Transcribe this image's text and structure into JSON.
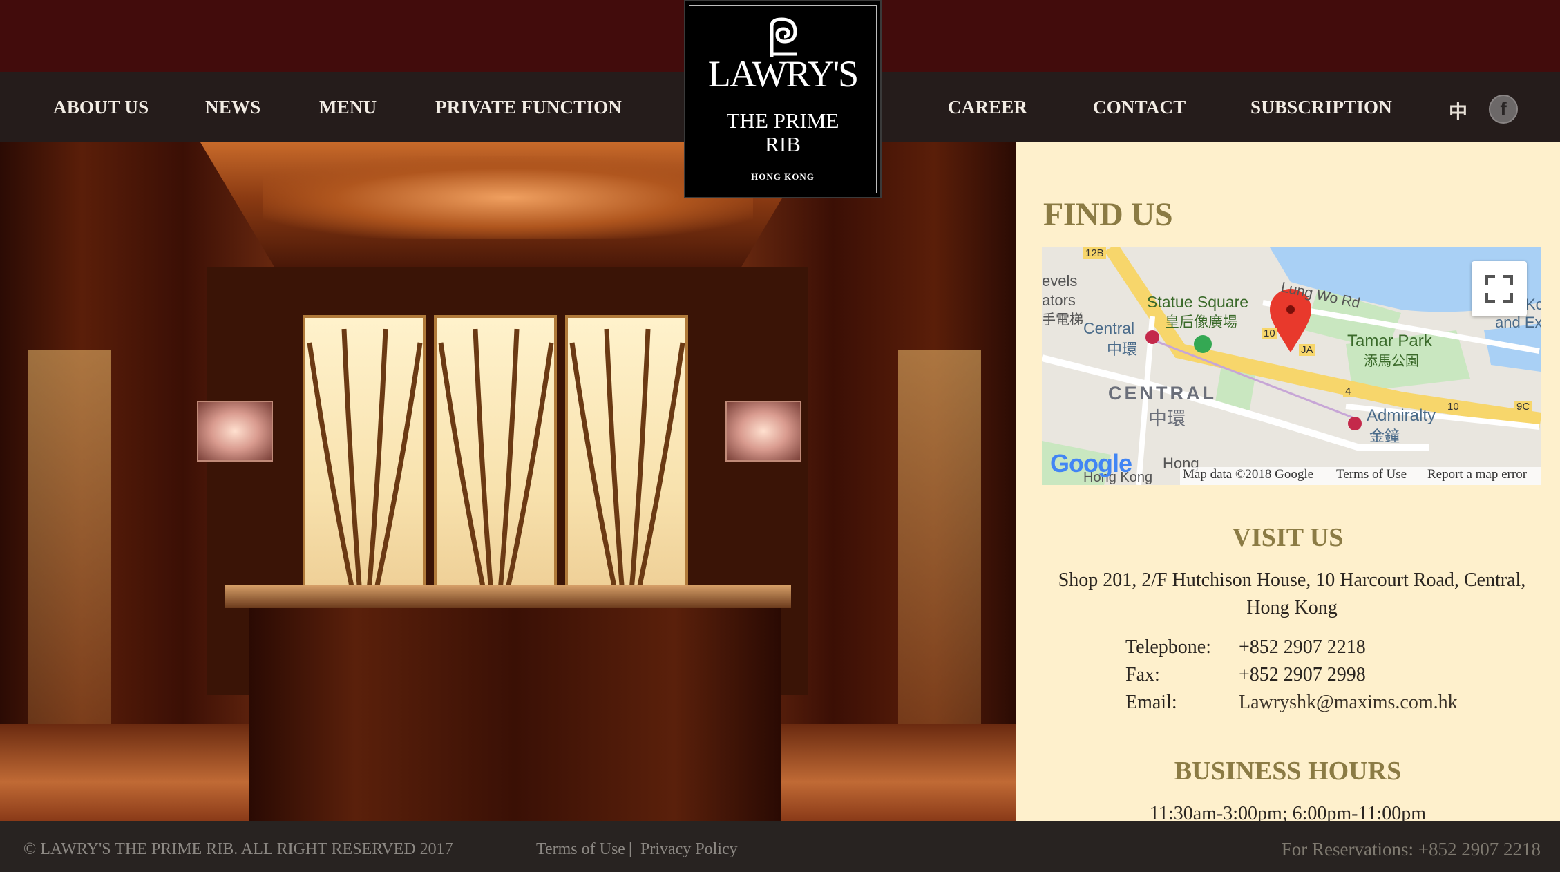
{
  "nav": {
    "about": "ABOUT US",
    "news": "NEWS",
    "menu": "MENU",
    "private": "PRIVATE FUNCTION",
    "career": "CAREER",
    "contact": "CONTACT",
    "subscription": "SUBSCRIPTION",
    "lang": "中",
    "facebook": "f"
  },
  "logo": {
    "brand": "LAWRY'S",
    "sub_line1": "THE PRIME",
    "sub_line2": "RIB",
    "city": "HONG KONG"
  },
  "find_us": {
    "title": "FIND US",
    "map": {
      "labels": {
        "statue_square": "Statue Square",
        "statue_square_zh": "皇后像廣場",
        "lung_wo": "Lung Wo Rd",
        "central": "Central",
        "central_zh": "中環",
        "central_district": "CENTRAL",
        "central_district_zh": "中環",
        "tamar": "Tamar Park",
        "tamar_zh": "添馬公園",
        "admiralty": "Admiralty",
        "admiralty_zh": "金鐘",
        "levels": "evels",
        "ators": "ators",
        "ators_zh": "手電梯",
        "and_ex": "and Ex",
        "kc": "Kc",
        "hong": "Hong",
        "hong_kong": "Hong Kong",
        "r12b": "12B",
        "r10": "10",
        "r4": "4",
        "r10b": "10",
        "r9c": "9C",
        "ja": "JA"
      },
      "google": "Google",
      "map_data": "Map data ©2018 Google",
      "terms": "Terms of Use",
      "report": "Report a map error"
    }
  },
  "visit": {
    "title": "VISIT US",
    "address_line1": "Shop 201, 2/F Hutchison House, 10 Harcourt Road, Central,",
    "address_line2": "Hong Kong",
    "tel_label": "Telepbone:",
    "tel": "+852 2907 2218",
    "fax_label": "Fax:",
    "fax": "+852 2907 2998",
    "email_label": "Email:",
    "email": "Lawryshk@maxims.com.hk"
  },
  "hours": {
    "title": "BUSINESS HOURS",
    "value": "11:30am-3:00pm; 6:00pm-11:00pm"
  },
  "footer": {
    "copyright": "© LAWRY'S THE PRIME RIB. ALL RIGHT RESERVED 2017",
    "terms": "Terms of Use",
    "divider": "|",
    "privacy": "Privacy Policy",
    "reservations": "For Reservations: +852 2907 2218"
  },
  "colors": {
    "top_bar": "#420c0c",
    "nav_bar": "#251c1b",
    "panel_bg": "#fef0cc",
    "heading_gold": "#8b7b44"
  }
}
